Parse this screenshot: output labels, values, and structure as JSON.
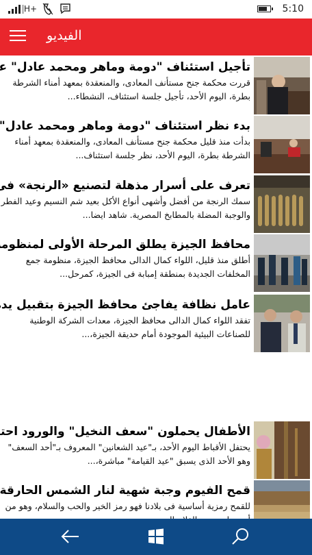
{
  "status": {
    "network": "H+",
    "time": "5:10"
  },
  "appbar": {
    "title": "الفيديو",
    "menu_icon": "hamburger-icon"
  },
  "articles": [
    {
      "headline": "تأجيل استئناف \"دومة وماهر ومحمد عادل\" على حكم",
      "summary": "قررت محكمة جنح مستأنف المعادى، والمنعقدة بمعهد أمناء الشرطة بطرة، اليوم الأحد، تأجيل جلسة استئناف، النشطاء..."
    },
    {
      "headline": "بدء نظر استئناف \"دومة وماهر ومحمد عادل\" على",
      "summary": "بدأت منذ قليل محكمة جنح مستأنف المعادى، والمنعقدة بمعهد أمناء الشرطة بطرة، اليوم الأحد، نظر جلسة استئناف..."
    },
    {
      "headline": "تعرف على أسرار مذهلة لتصنيع «الرنجة» فى مصر",
      "summary": "سمك الرنجة من أفضل وأشهى أنواع الأكل بعيد شم النسيم وعيد الفطر والوجبة المضلة بالمطابخ المصرية. شاهد ايضا..."
    },
    {
      "headline": "محافظ الجيزة يطلق المرحلة الأولى لمنظومة النظافة",
      "summary": "أطلق منذ قليل، اللواء كمال الدالى محافظ الجيزة، منظومة جمع المخلفات الجديدة بمنطقة إمبابة فى الجيزة، كمرحل..."
    },
    {
      "headline": "عامل نظافة يفاجئ محافظ الجيزة بتقبيل يده فى إمبابة",
      "summary": "تفقد اللواء كمال الدالى محافظ الجيزة، معدات الشركة الوطنية للصناعات البيئية الموجودة أمام حديقة الجيزة،..."
    },
    {
      "headline": "الأطفال يحملون \"سعف النخيل\" والورود احتفالا بالعيد",
      "summary": "يحتفل الأقباط اليوم الأحد، بـ\"عيد الشعانين\" المعروف بـ\"أحد السعف\" وهو الأحد الذى يسبق \"عيد القيامة\" مباشرة،..."
    },
    {
      "headline": "قمح الفيوم وجبة شهية لنار الشمس الحارقة وسط تراب",
      "summary": "للقمح رمزية أساسية فى بلادنا فهو رمز الخير والحب والسلام، وهو من أبرز ما يهتم به الفلاح المصرى ويعتنى به..."
    }
  ],
  "nav": {
    "back_icon": "back-arrow-icon",
    "home_icon": "windows-logo-icon",
    "search_icon": "search-icon"
  }
}
